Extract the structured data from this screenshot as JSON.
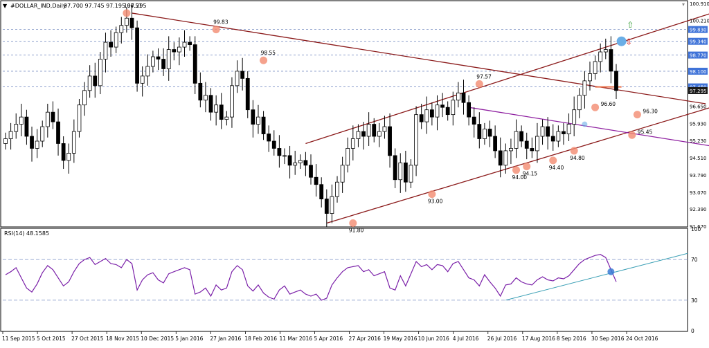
{
  "header": {
    "symbol": "#DOLLAR_IND,Daily",
    "ohlc": "97.700 97.745 97.195 97.295"
  },
  "colors": {
    "candle": "#000000",
    "grid": "#7a8fc4",
    "trend_red": "#8b1a1a",
    "trend_purple": "#8e1fa0",
    "marker": "#f28b70",
    "blue_marker": "#6aaee6",
    "rsi_line": "#7a1fa8",
    "rsi_trend": "#3a9fb5",
    "label_box": "#3f73d8",
    "current_box": "#1a1a1a",
    "horizontal_marker": "#e8704c"
  },
  "chart_data": [
    {
      "type": "candlestick",
      "title": "#DOLLAR_IND,Daily",
      "ylim": [
        91.67,
        100.91
      ],
      "y_ticks": [
        "100.910",
        "100.210",
        "99.830",
        "99.340",
        "98.770",
        "98.100",
        "97.450",
        "96.650",
        "95.930",
        "95.230",
        "94.510",
        "93.790",
        "93.070",
        "92.390",
        "91.670"
      ],
      "highlighted_levels": [
        "100.510",
        "99.830",
        "99.340",
        "98.770",
        "98.100",
        "97.450"
      ],
      "current_price": "97.295",
      "x_tick_labels": [
        "11 Sep 2015",
        "5 Oct 2015",
        "27 Oct 2015",
        "18 Nov 2015",
        "10 Dec 2015",
        "5 Jan 2016",
        "27 Jan 2016",
        "18 Feb 2016",
        "11 Mar 2016",
        "5 Apr 2016",
        "27 Apr 2016",
        "19 May 2016",
        "10 Jun 2016",
        "4 Jul 2016",
        "26 Jul 2016",
        "17 Aug 2016",
        "8 Sep 2016",
        "30 Sep 2016",
        "24 Oct 2016"
      ],
      "close_series": [
        95.3,
        95.6,
        95.9,
        96.2,
        95.4,
        94.9,
        95.2,
        95.8,
        96.4,
        96.0,
        95.1,
        94.4,
        94.7,
        95.6,
        96.7,
        97.3,
        97.9,
        97.5,
        98.6,
        99.3,
        99.1,
        99.7,
        100.0,
        100.3,
        99.9,
        97.6,
        97.9,
        98.3,
        98.7,
        98.6,
        98.2,
        99.0,
        98.9,
        99.1,
        99.3,
        99.2,
        97.6,
        96.9,
        97.1,
        96.4,
        96.7,
        96.1,
        96.2,
        97.5,
        98.1,
        97.8,
        96.5,
        95.9,
        96.2,
        95.5,
        95.2,
        94.9,
        94.6,
        94.6,
        94.2,
        94.3,
        94.4,
        94.2,
        93.7,
        93.4,
        92.8,
        92.2,
        92.9,
        93.5,
        94.2,
        94.9,
        95.3,
        95.6,
        95.4,
        95.9,
        95.4,
        95.6,
        95.8,
        94.6,
        93.6,
        94.3,
        93.5,
        94.2,
        96.3,
        96.0,
        96.5,
        96.2,
        96.7,
        96.6,
        96.3,
        96.9,
        97.2,
        96.8,
        96.2,
        95.9,
        95.3,
        95.7,
        95.4,
        94.8,
        94.2,
        94.8,
        94.9,
        95.6,
        95.2,
        94.9,
        94.8,
        95.4,
        95.8,
        95.4,
        95.2,
        95.6,
        95.5,
        95.9,
        96.5,
        97.1,
        97.7,
        98.0,
        98.5,
        98.9,
        99.0,
        98.1,
        97.3
      ],
      "annotations": [
        {
          "label": "100.51"
        },
        {
          "label": "99.83"
        },
        {
          "label": "98.55"
        },
        {
          "label": "97.57"
        },
        {
          "label": "96.60"
        },
        {
          "label": "96.30"
        },
        {
          "label": "95.45"
        },
        {
          "label": "94.80"
        },
        {
          "label": "94.40"
        },
        {
          "label": "94.15"
        },
        {
          "label": "94.00"
        },
        {
          "label": "93.00"
        },
        {
          "label": "91.80"
        }
      ]
    },
    {
      "type": "line",
      "title": "RSI(14) 48.1585",
      "ylim": [
        0,
        100
      ],
      "y_ticks": [
        "100",
        "70",
        "30",
        "0"
      ],
      "levels": [
        70,
        30
      ],
      "rsi_series": [
        55,
        58,
        62,
        52,
        42,
        38,
        46,
        57,
        64,
        60,
        52,
        44,
        48,
        58,
        66,
        70,
        72,
        65,
        68,
        71,
        66,
        65,
        62,
        70,
        66,
        40,
        50,
        55,
        57,
        50,
        47,
        56,
        58,
        60,
        62,
        60,
        36,
        38,
        42,
        34,
        45,
        40,
        42,
        58,
        64,
        60,
        44,
        39,
        45,
        37,
        33,
        31,
        40,
        44,
        36,
        38,
        40,
        36,
        34,
        36,
        30,
        32,
        45,
        52,
        58,
        62,
        63,
        64,
        58,
        60,
        54,
        56,
        58,
        42,
        40,
        54,
        44,
        56,
        68,
        63,
        65,
        60,
        65,
        64,
        58,
        66,
        68,
        60,
        52,
        50,
        44,
        55,
        48,
        42,
        34,
        45,
        46,
        52,
        48,
        46,
        45,
        50,
        53,
        50,
        49,
        52,
        51,
        54,
        60,
        66,
        70,
        72,
        74,
        75,
        72,
        60,
        48.16
      ]
    }
  ]
}
